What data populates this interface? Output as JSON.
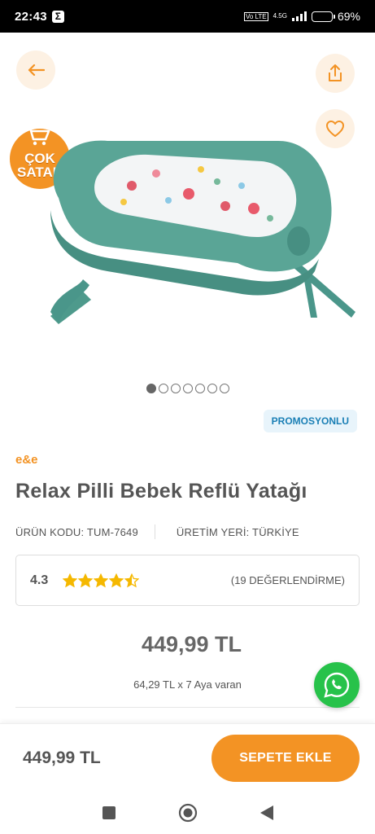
{
  "status_bar": {
    "time": "22:43",
    "network_label": "4.5G",
    "volte_label": "Vo LTE",
    "battery_percent": "69%",
    "battery_level": 0.69
  },
  "header": {
    "back_icon": "arrow-left-icon",
    "share_icon": "share-icon",
    "favorite_icon": "heart-outline-icon"
  },
  "badge": {
    "line1": "ÇOK",
    "line2": "SATAN"
  },
  "gallery": {
    "image_count": 7,
    "active_index": 0
  },
  "promo_tag": "PROMOSYONLU",
  "brand": "e&e",
  "product_title": "Relax Pilli Bebek Reflü Yatağı",
  "product_code": "ÜRÜN KODU: TUM-7649",
  "origin": "ÜRETİM YERİ: TÜRKİYE",
  "rating": {
    "score": "4.3",
    "stars_value": 4.3,
    "count_text": "(19 DEĞERLENDİRME)"
  },
  "price": "449,99 TL",
  "installment": "64,29 TL x 7 Aya varan",
  "bottom_bar": {
    "price": "449,99 TL",
    "add_to_cart_label": "SEPETE EKLE"
  },
  "colors": {
    "accent": "#f39324",
    "promo_text": "#1a7fb5",
    "star": "#f5b800",
    "whatsapp": "#27c24a"
  }
}
